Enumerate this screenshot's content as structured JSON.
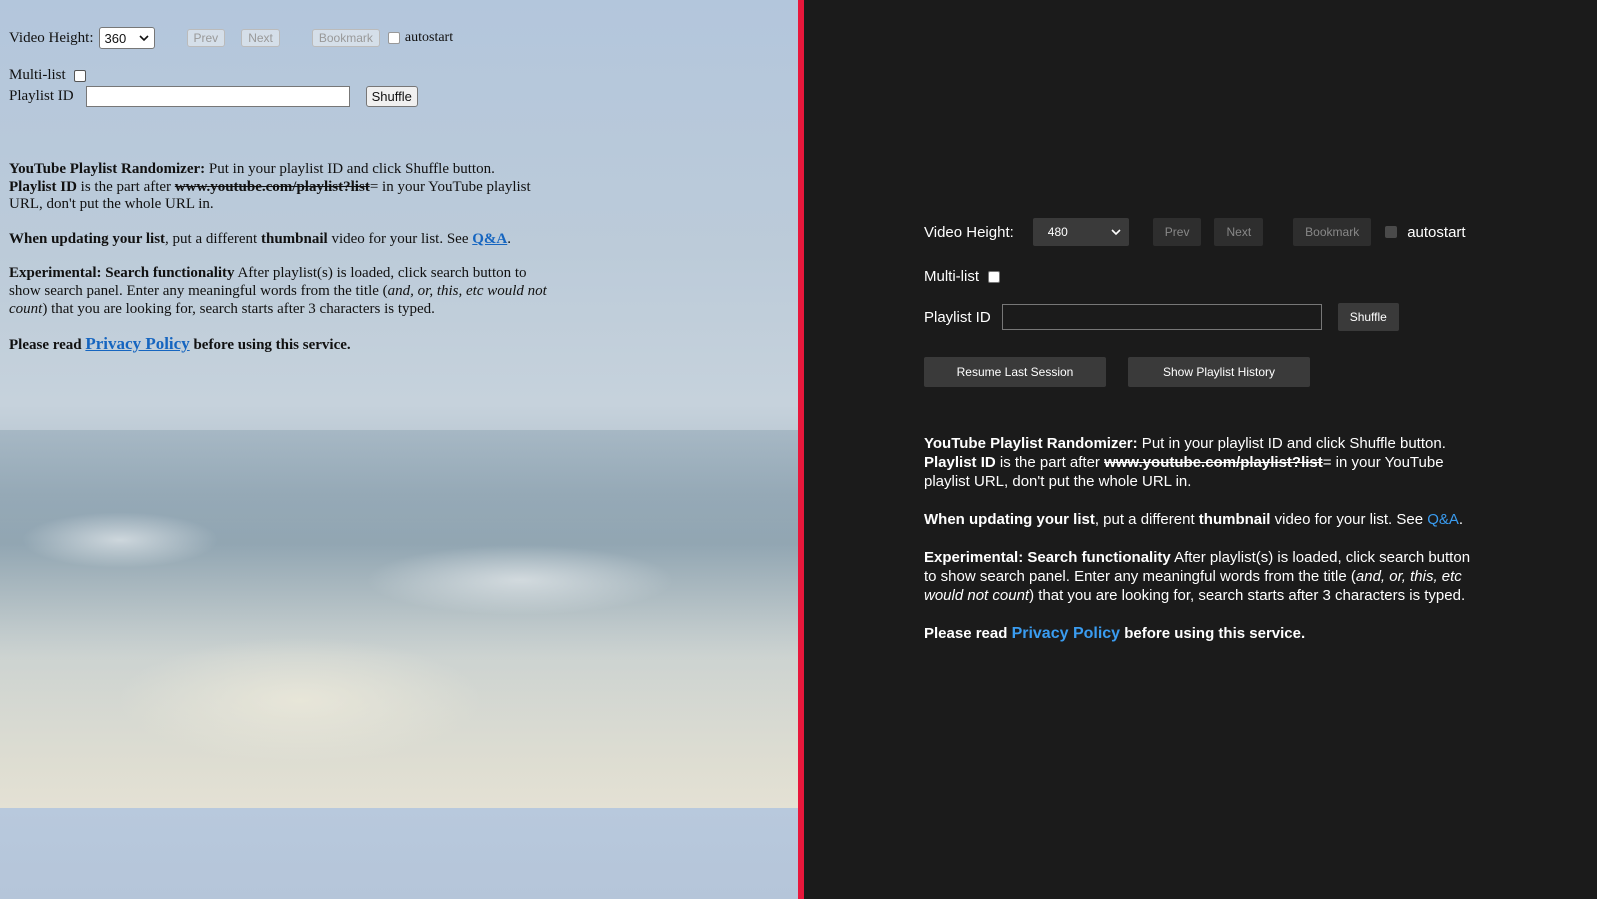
{
  "controls": {
    "video_height_label": "Video Height:",
    "left_height_value": "360",
    "right_height_value": "480",
    "prev_label": "Prev",
    "next_label": "Next",
    "bookmark_label": "Bookmark",
    "autostart_label": "autostart",
    "multilist_label": "Multi-list",
    "playlist_id_label": "Playlist ID",
    "playlist_id_value": "",
    "shuffle_label": "Shuffle",
    "resume_label": "Resume Last Session",
    "history_label": "Show Playlist History"
  },
  "info": {
    "p1_bold": "YouTube Playlist Randomizer:",
    "p1_text": " Put in your playlist ID and click Shuffle button.",
    "p1b_bold": "Playlist ID",
    "p1b_text1": " is the part after ",
    "p1b_strike": "www.youtube.com/playlist?list",
    "p1b_text2": "= in your YouTube playlist URL, don't put the whole URL in.",
    "p2_bold1": "When updating your list",
    "p2_text1": ", put a different ",
    "p2_bold2": "thumbnail",
    "p2_text2": " video for your list. See ",
    "p2_link": "Q&A",
    "p2_end": ".",
    "p3_bold": "Experimental: Search functionality",
    "p3_text1": " After playlist(s) is loaded, click search button to show search panel. Enter any meaningful words from the title (",
    "p3_italic": "and, or, this, etc would not count",
    "p3_text2": ") that you are looking for, search starts after 3 characters is typed.",
    "p4_text1": "Please read ",
    "p4_link": "Privacy Policy",
    "p4_text2": " before using this service."
  },
  "colors": {
    "divider": "#e8173b",
    "link_left": "#1565c0",
    "link_right": "#3a9cf0",
    "dark_bg": "#1b1b1b"
  },
  "icons": {
    "select_arrow": "chevron-down-icon"
  }
}
